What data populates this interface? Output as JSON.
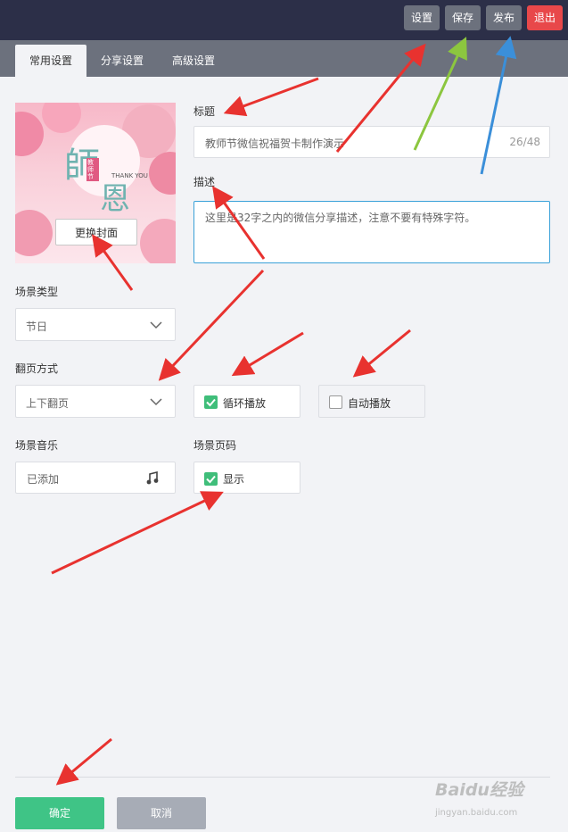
{
  "topbar": {
    "settings": "设置",
    "save": "保存",
    "publish": "发布",
    "exit": "退出"
  },
  "tabs": [
    "常用设置",
    "分享设置",
    "高级设置"
  ],
  "cover": {
    "change_label": "更换封面",
    "art": {
      "big1": "師",
      "big2": "恩",
      "thank": "THANK YOU",
      "small": "教师节"
    }
  },
  "title_field": {
    "label": "标题",
    "value": "教师节微信祝福贺卡制作演示",
    "counter": "26/48"
  },
  "desc_field": {
    "label": "描述",
    "value": "这里是32字之内的微信分享描述，注意不要有特殊字符。"
  },
  "scene_type": {
    "label": "场景类型",
    "value": "节日"
  },
  "page_turn": {
    "label": "翻页方式",
    "value": "上下翻页"
  },
  "loop_play": {
    "label": "循环播放",
    "checked": true
  },
  "auto_play": {
    "label": "自动播放",
    "checked": false
  },
  "music": {
    "label": "场景音乐",
    "value": "已添加"
  },
  "page_number": {
    "label": "场景页码",
    "option": "显示",
    "checked": true
  },
  "footer": {
    "confirm": "确定",
    "cancel": "取消"
  },
  "watermark": {
    "brand": "Baidu经验",
    "url": "jingyan.baidu.com"
  },
  "colors": {
    "accent_green": "#3fc486",
    "exit_red": "#e8484a",
    "topbar": "#2c2f48",
    "tabbar": "#6c717d"
  }
}
